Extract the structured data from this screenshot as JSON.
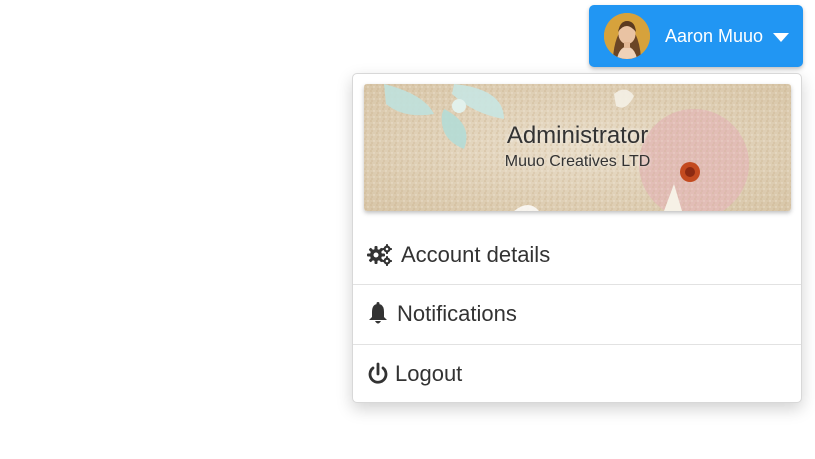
{
  "user": {
    "name": "Aaron Muuo"
  },
  "profile": {
    "role": "Administrator",
    "company": "Muuo Creatives LTD"
  },
  "menu": {
    "items": [
      {
        "label": "Account details",
        "icon": "gears-icon"
      },
      {
        "label": "Notifications",
        "icon": "bell-icon"
      },
      {
        "label": "Logout",
        "icon": "power-icon"
      }
    ]
  },
  "colors": {
    "accent": "#2196f3",
    "text": "#333333"
  }
}
